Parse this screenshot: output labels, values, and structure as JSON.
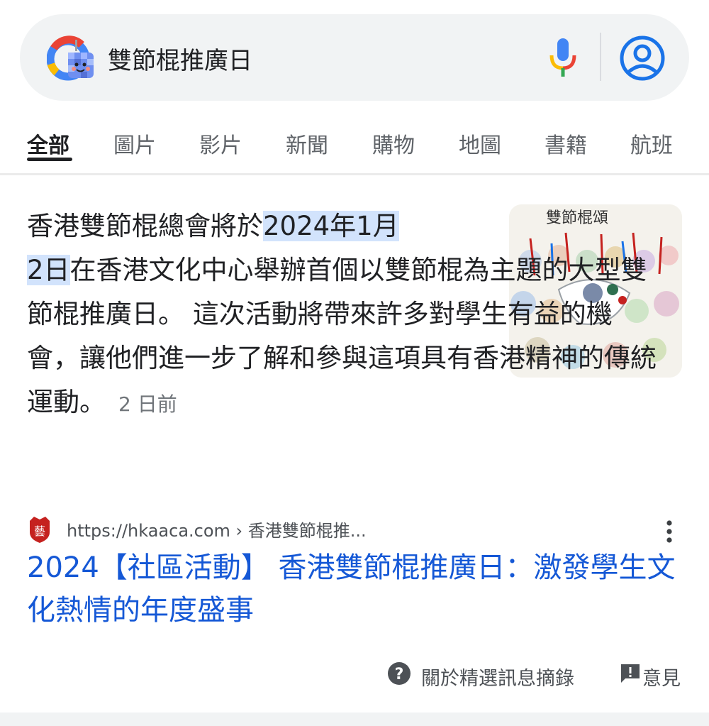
{
  "search": {
    "query": "雙節棍推廣日"
  },
  "tabs": [
    {
      "label": "全部",
      "active": true
    },
    {
      "label": "圖片"
    },
    {
      "label": "影片"
    },
    {
      "label": "新聞"
    },
    {
      "label": "購物"
    },
    {
      "label": "地圖"
    },
    {
      "label": "書籍"
    },
    {
      "label": "航班"
    }
  ],
  "snippet": {
    "text_before": "香港雙節棍總會將於",
    "highlight_1": "2024年1月",
    "highlight_2": "2日",
    "text_after": "在香港文化中心舉辦首個以雙節棍為主題的大型雙節棍推廣日。 這次活動將帶來許多對學生有益的機會，讓他們進一步了解和參與這項具有香港精神的傳統運動。",
    "ago": "2 日前",
    "thumbnail_caption": "雙節棍頌"
  },
  "result": {
    "url": "https://hkaaca.com › 香港雙節棍推...",
    "title": "2024【社區活動】 香港雙節棍推廣日：激發學生文化熱情的年度盛事",
    "favicon_text": "藝"
  },
  "footer": {
    "about_label": "關於精選訊息摘錄",
    "feedback_label": "意見"
  },
  "colors": {
    "link": "#1558d6",
    "highlight": "#d2e3fc",
    "search_bg": "#f1f3f4",
    "account_blue": "#1a73e8",
    "favicon_red": "#c5221f"
  },
  "icons": [
    "google-logo-icon",
    "mic-icon",
    "account-icon",
    "more-vert-icon",
    "help-icon",
    "feedback-icon"
  ]
}
